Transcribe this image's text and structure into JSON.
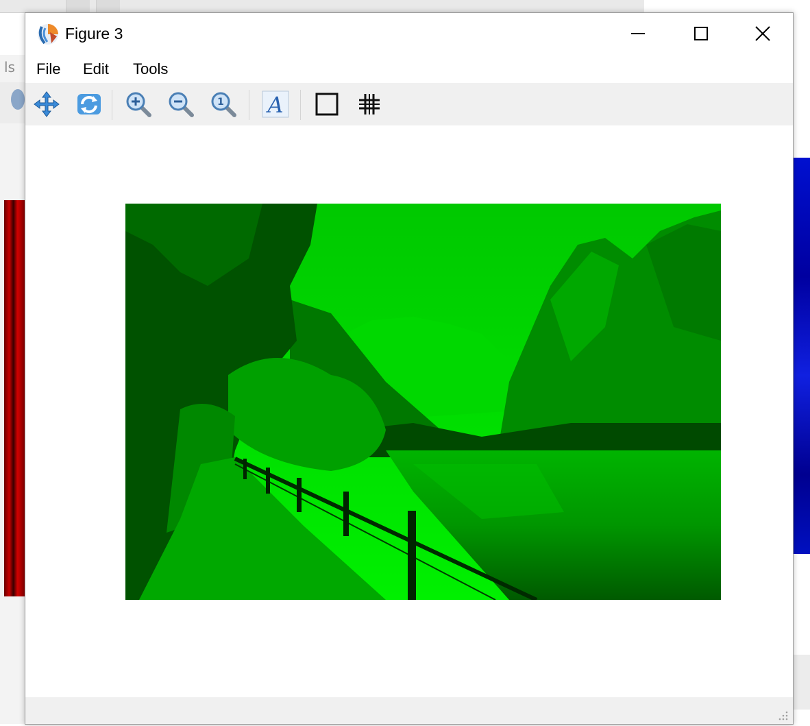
{
  "window": {
    "title": "Figure 3",
    "controls": {
      "minimize": "minimize",
      "maximize": "maximize",
      "close": "close"
    }
  },
  "background": {
    "left_window_text": "ls"
  },
  "menu": {
    "items": [
      "File",
      "Edit",
      "Tools"
    ]
  },
  "toolbar": {
    "tools": [
      "pan-icon",
      "reset-view-icon",
      "zoom-in-icon",
      "zoom-out-icon",
      "zoom-actual-icon",
      "insert-text-icon",
      "rectangle-icon",
      "grid-icon"
    ]
  },
  "figure": {
    "image": "green-channel landscape photo (lake, mountains, fenced path)",
    "colors": {
      "tint": "#00ff00",
      "red_panel": "#c80000",
      "blue_panel": "#0000c8"
    }
  }
}
